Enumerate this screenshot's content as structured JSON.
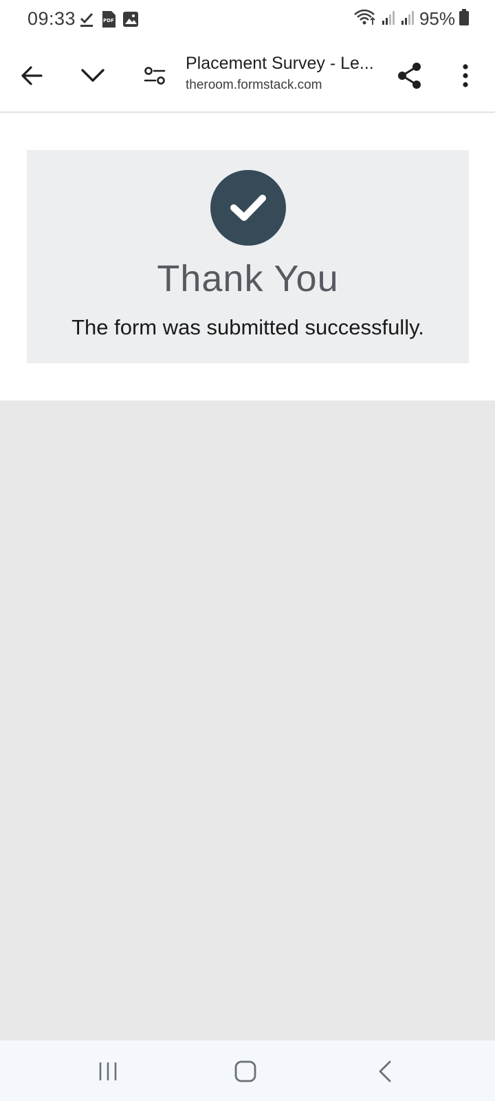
{
  "status_bar": {
    "time": "09:33",
    "left_icons": [
      "checkmark-download-icon",
      "pdf-file-icon",
      "image-icon"
    ],
    "right_icons": [
      "wifi-icon",
      "signal-icon-1",
      "signal-icon-2",
      "battery-icon"
    ],
    "battery_percent": "95%"
  },
  "toolbar": {
    "page_title": "Placement Survey - Le...",
    "page_url": "theroom.formstack.com",
    "buttons": [
      "back-arrow-icon",
      "chevron-down-icon",
      "page-settings-icon",
      "share-icon",
      "more-vert-icon"
    ]
  },
  "confirmation": {
    "icon": "check-circle-icon",
    "title": "Thank You",
    "message": "The form was submitted successfully.",
    "icon_bg_color": "#374a58",
    "card_bg_color": "#edeef0"
  },
  "nav_bar": {
    "buttons": [
      "recent-apps-icon",
      "home-icon",
      "back-icon"
    ]
  }
}
